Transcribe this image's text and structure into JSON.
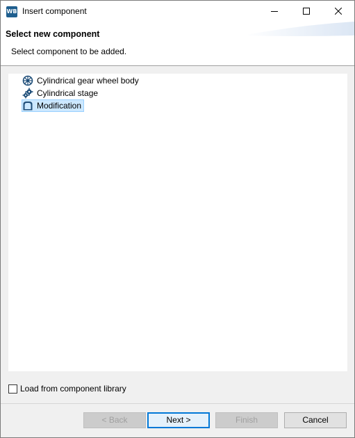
{
  "window": {
    "title": "Insert component",
    "app_icon_text": "WB"
  },
  "banner": {
    "title": "Select new component",
    "description": "Select component to be added."
  },
  "tree": {
    "items": [
      {
        "label": "Cylindrical gear wheel body",
        "icon": "gear-wheel-icon"
      },
      {
        "label": "Cylindrical stage",
        "icon": "gear-stage-icon"
      },
      {
        "label": "Modification",
        "icon": "modification-icon",
        "selected": true
      }
    ]
  },
  "options": {
    "load_from_library_label": "Load from component library",
    "load_from_library_checked": false
  },
  "buttons": {
    "back": "< Back",
    "next": "Next >",
    "finish": "Finish",
    "cancel": "Cancel"
  },
  "colors": {
    "selection_bg": "#cce8ff",
    "selection_border": "#99d1ff",
    "default_button_border": "#0078d7",
    "icon_blue": "#1f4e79"
  }
}
